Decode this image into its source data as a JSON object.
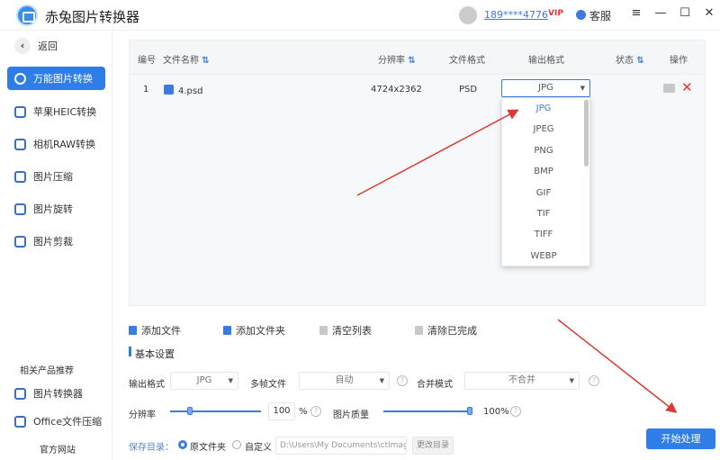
{
  "app": {
    "title": "赤兔图片转换器",
    "user_phone": "189****4776",
    "vip_badge": "VIP",
    "service": "客服",
    "menu_icon": "≡",
    "minimize_icon": "—",
    "maximize_icon": "☐",
    "close_icon": "✕"
  },
  "sidebar": {
    "back": "返回",
    "items": [
      {
        "label": "万能图片转换",
        "active": true
      },
      {
        "label": "苹果HEIC转换"
      },
      {
        "label": "相机RAW转换"
      },
      {
        "label": "图片压缩"
      },
      {
        "label": "图片旋转"
      },
      {
        "label": "图片剪裁"
      }
    ],
    "related_title": "相关产品推荐",
    "related": [
      {
        "label": "图片转换器"
      },
      {
        "label": "Office文件压缩"
      }
    ],
    "website": "官方网站"
  },
  "table": {
    "columns": [
      "编号",
      "文件名称",
      "分辨率",
      "文件格式",
      "输出格式",
      "状态",
      "操作"
    ],
    "sort_icon": "⇅",
    "rows": [
      {
        "index": "1",
        "name": "4.psd",
        "resolution": "4724x2362",
        "format": "PSD",
        "output": "JPG"
      }
    ]
  },
  "dropdown": {
    "options": [
      "JPG",
      "JPEG",
      "PNG",
      "BMP",
      "GIF",
      "TIF",
      "TIFF",
      "WEBP"
    ],
    "selected": "JPG"
  },
  "toolbar": {
    "add_file": "添加文件",
    "add_folder": "添加文件夹",
    "clear_list": "清空列表",
    "clear_done": "清除已完成"
  },
  "settings": {
    "title": "基本设置",
    "output_format_label": "输出格式",
    "output_format": "JPG",
    "multiframe_label": "多帧文件",
    "multiframe": "自动",
    "merge_label": "合并模式",
    "merge": "不合并",
    "resolution_label": "分辨率",
    "resolution": "100",
    "resolution_unit": "%",
    "resolution_slider_pct": 100,
    "quality_label": "图片质量",
    "quality": "100%",
    "quality_pct": 100,
    "save_dir_label": "保存目录：",
    "radio_original": "原文件夹",
    "radio_custom": "自定义",
    "save_path": "D:\\Users\\My Documents\\ctImageC",
    "change_dir": "更改目录",
    "help_icon": "?"
  },
  "start_button": "开始处理",
  "colors": {
    "accent": "#2f7ee8",
    "annotation_arrow": "#d93a32",
    "delete": "#e33333"
  }
}
